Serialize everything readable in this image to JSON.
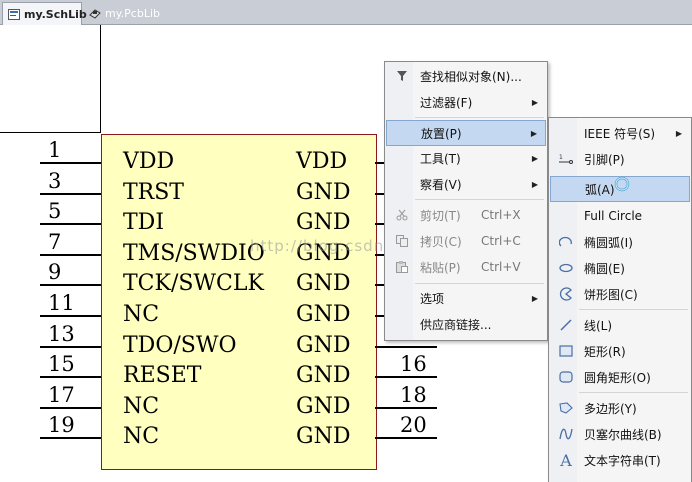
{
  "tabs": [
    {
      "label": "my.SchLib",
      "icon": "schlib-document-icon"
    },
    {
      "label": "my.PcbLib",
      "icon": "pcblib-document-icon"
    }
  ],
  "schematic": {
    "left_pins": [
      {
        "number": "1",
        "name": "VDD"
      },
      {
        "number": "3",
        "name": "TRST"
      },
      {
        "number": "5",
        "name": "TDI"
      },
      {
        "number": "7",
        "name": "TMS/SWDIO"
      },
      {
        "number": "9",
        "name": "TCK/SWCLK"
      },
      {
        "number": "11",
        "name": "NC"
      },
      {
        "number": "13",
        "name": "TDO/SWO"
      },
      {
        "number": "15",
        "name": "RESET"
      },
      {
        "number": "17",
        "name": "NC"
      },
      {
        "number": "19",
        "name": "NC"
      }
    ],
    "right_pin_names": [
      "VDD",
      "GND",
      "GND",
      "GND",
      "GND",
      "GND",
      "GND",
      "GND",
      "GND",
      "GND"
    ],
    "right_pin_numbers_visible": [
      "16",
      "18",
      "20"
    ],
    "watermark": "http://blog.csdn.net/"
  },
  "context_menu": {
    "items": [
      {
        "label": "查找相似对象(N)...",
        "icon": "filter-icon"
      },
      {
        "label": "过滤器(F)",
        "submenu": true
      },
      {
        "label": "放置(P)",
        "submenu": true,
        "selected": true
      },
      {
        "label": "工具(T)",
        "submenu": true
      },
      {
        "label": "察看(V)",
        "submenu": true
      },
      {
        "label": "剪切(T)",
        "shortcut": "Ctrl+X",
        "disabled": true,
        "icon": "scissors-icon"
      },
      {
        "label": "拷贝(C)",
        "shortcut": "Ctrl+C",
        "disabled": true,
        "icon": "copy-icon"
      },
      {
        "label": "粘贴(P)",
        "shortcut": "Ctrl+V",
        "disabled": true,
        "icon": "paste-icon"
      },
      {
        "label": "选项",
        "submenu": true
      },
      {
        "label": "供应商链接..."
      }
    ]
  },
  "place_submenu": {
    "items": [
      {
        "label": "IEEE 符号(S)",
        "submenu": true
      },
      {
        "label": "引脚(P)",
        "icon": "pin-icon"
      },
      {
        "label": "弧(A)",
        "selected": true
      },
      {
        "label": "Full Circle"
      },
      {
        "label": "椭圆弧(I)",
        "icon": "elliptical-arc-icon"
      },
      {
        "label": "椭圆(E)",
        "icon": "ellipse-icon"
      },
      {
        "label": "饼形图(C)",
        "icon": "pie-icon"
      },
      {
        "label": "线(L)",
        "icon": "line-icon"
      },
      {
        "label": "矩形(R)",
        "icon": "rectangle-icon"
      },
      {
        "label": "圆角矩形(O)",
        "icon": "rounded-rectangle-icon"
      },
      {
        "label": "多边形(Y)",
        "icon": "polygon-icon"
      },
      {
        "label": "贝塞尔曲线(B)",
        "icon": "bezier-icon"
      },
      {
        "label": "文本字符串(T)",
        "icon": "text-string-icon"
      }
    ]
  }
}
